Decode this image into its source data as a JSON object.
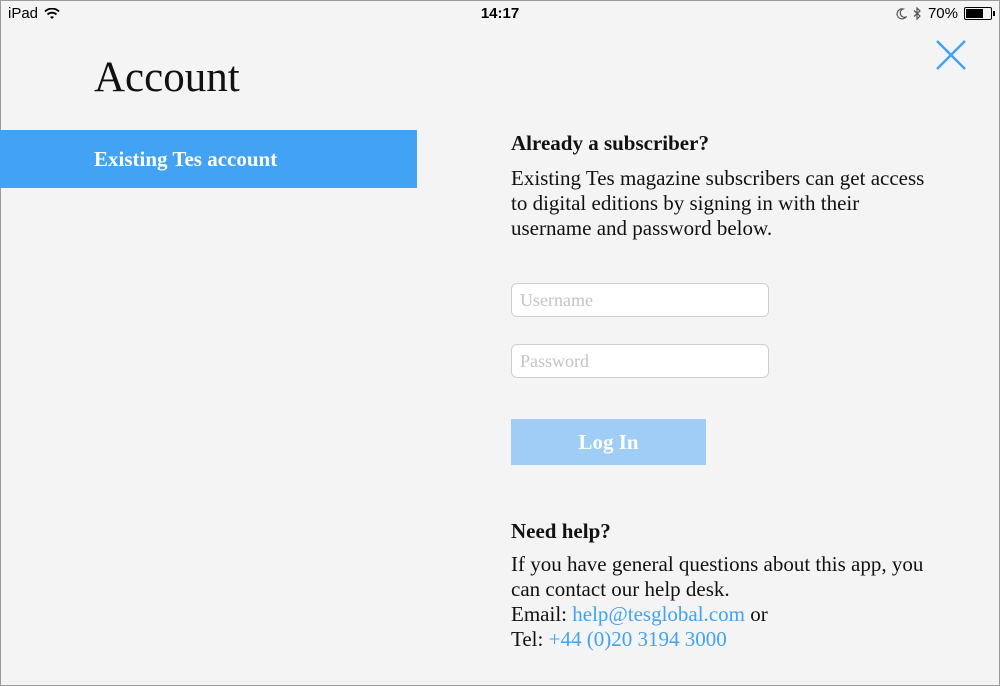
{
  "status_bar": {
    "device": "iPad",
    "time": "14:17",
    "battery_percent": "70%",
    "battery_level": 0.7,
    "icons": [
      "wifi-icon",
      "moon-icon",
      "bluetooth-icon",
      "battery-icon"
    ]
  },
  "page": {
    "title": "Account",
    "close_icon": "close-icon"
  },
  "sidebar": {
    "items": [
      {
        "label": "Existing Tes account",
        "selected": true
      }
    ]
  },
  "login": {
    "heading": "Already a subscriber?",
    "description": "Existing Tes magazine subscribers can get access to digital editions by signing in with their username and password below.",
    "username_placeholder": "Username",
    "username_value": "",
    "password_placeholder": "Password",
    "password_value": "",
    "button_label": "Log In"
  },
  "help": {
    "heading": "Need help?",
    "line1": "If you have general questions about this app, you can contact our help desk.",
    "email_label": "Email: ",
    "email": "help@tesglobal.com",
    "email_suffix": " or",
    "tel_label": "Tel: ",
    "tel": "+44 (0)20 3194 3000"
  },
  "colors": {
    "accent": "#42a2f3",
    "button_disabled": "#9fcdf5",
    "background": "#f4f4f4"
  }
}
